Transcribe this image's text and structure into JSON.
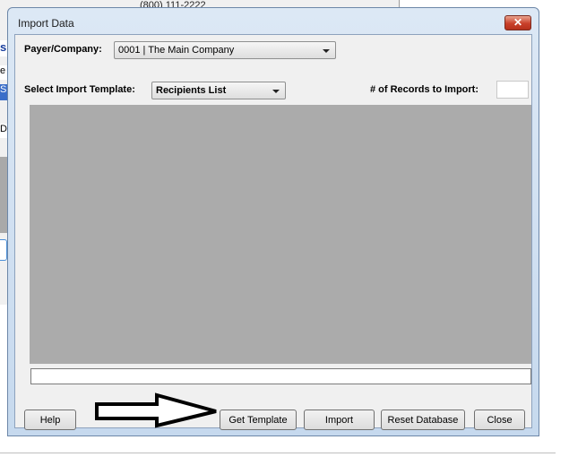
{
  "background": {
    "phone_text": "(800) 111-2222",
    "strip_labels": [
      "s",
      "e",
      "S",
      "D"
    ]
  },
  "dialog": {
    "title": "Import Data",
    "close_glyph": "✕",
    "payer_label": "Payer/Company:",
    "payer_value": "0001 | The Main Company",
    "template_label": "Select Import Template:",
    "template_value": "Recipients List",
    "records_label": "# of Records to Import:",
    "records_value": "",
    "status_text": "",
    "buttons": {
      "help": "Help",
      "get_template": "Get Template",
      "import": "Import",
      "reset_database": "Reset Database",
      "close": "Close"
    }
  },
  "annotation": {
    "icon": "right-arrow-icon",
    "color": "#000000"
  }
}
